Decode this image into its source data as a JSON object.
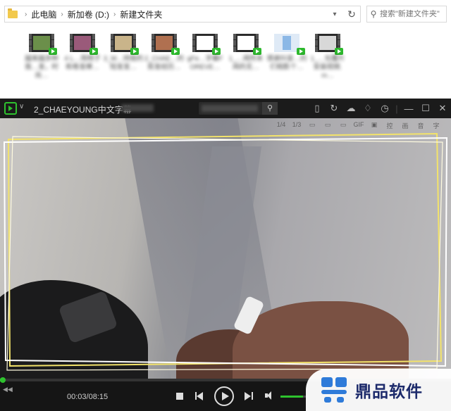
{
  "explorer": {
    "breadcrumb": [
      "此电脑",
      "新加卷 (D:)",
      "新建文件夹"
    ],
    "search_placeholder": "搜索\"新建文件夹\"",
    "files": [
      {
        "name": "越来越多种我…发，时尚…",
        "thumb_color": "#6b8f4a"
      },
      {
        "name": "4 L…用椅子和卷发棒…",
        "thumb_color": "#9a5a7a"
      },
      {
        "name": "3_M…持我的短发发…",
        "thumb_color": "#c9b48a"
      },
      {
        "name": "2_CHAE…的剪发经历…",
        "thumb_color": "#b07050"
      },
      {
        "name": "gFe…字幕FOREVE…",
        "thumb_color": "#2b2b2b"
      },
      {
        "name": "1_…闻所未闻的无…",
        "thumb_color": "#2b2b2b"
      },
      {
        "name": "感谢抖音…的们相影个…",
        "thumb_color": "#dfeaf6"
      },
      {
        "name": "1_…包覆片安装视频.m…",
        "thumb_color": "#d8d8d8"
      }
    ]
  },
  "player": {
    "title": "2_CHAEYOUNG中文字幕",
    "time": "00:03/08:15",
    "progress_fraction": 0.006,
    "volume_fraction": 0.8,
    "accent_color": "#2ec22e",
    "overlay_labels": [
      "1/4",
      "1/3",
      "GIF",
      "控",
      "画",
      "音",
      "字"
    ]
  },
  "watermark": {
    "text": "鼎品软件",
    "color": "#1c2a6b"
  }
}
